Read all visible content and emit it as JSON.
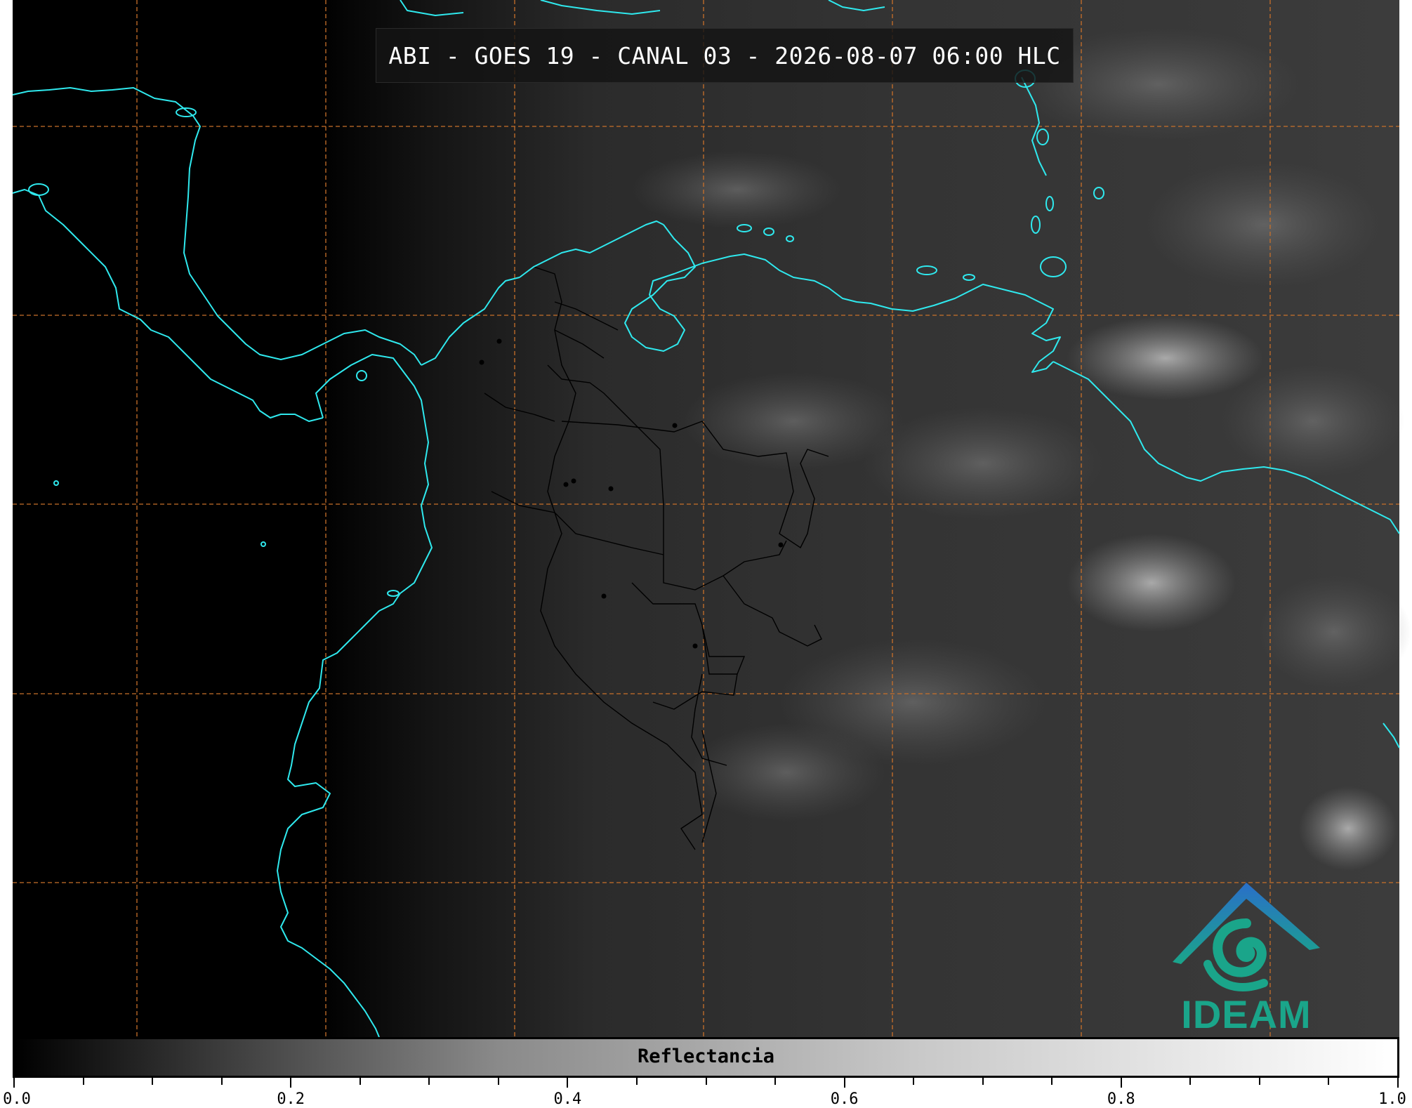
{
  "title": "ABI - GOES 19 - CANAL 03 - 2026-08-07 06:00 HLC",
  "colorbar": {
    "label": "Reflectancia",
    "range": [
      0.0,
      1.0
    ],
    "ticks": [
      "0.0",
      "0.2",
      "0.4",
      "0.6",
      "0.8",
      "1.0"
    ]
  },
  "logo": {
    "text": "IDEAM",
    "color": "#1aa58a"
  },
  "colors": {
    "coastline": "#2fe9ee",
    "gridlines": "#c8702a",
    "borders": "#000000"
  }
}
